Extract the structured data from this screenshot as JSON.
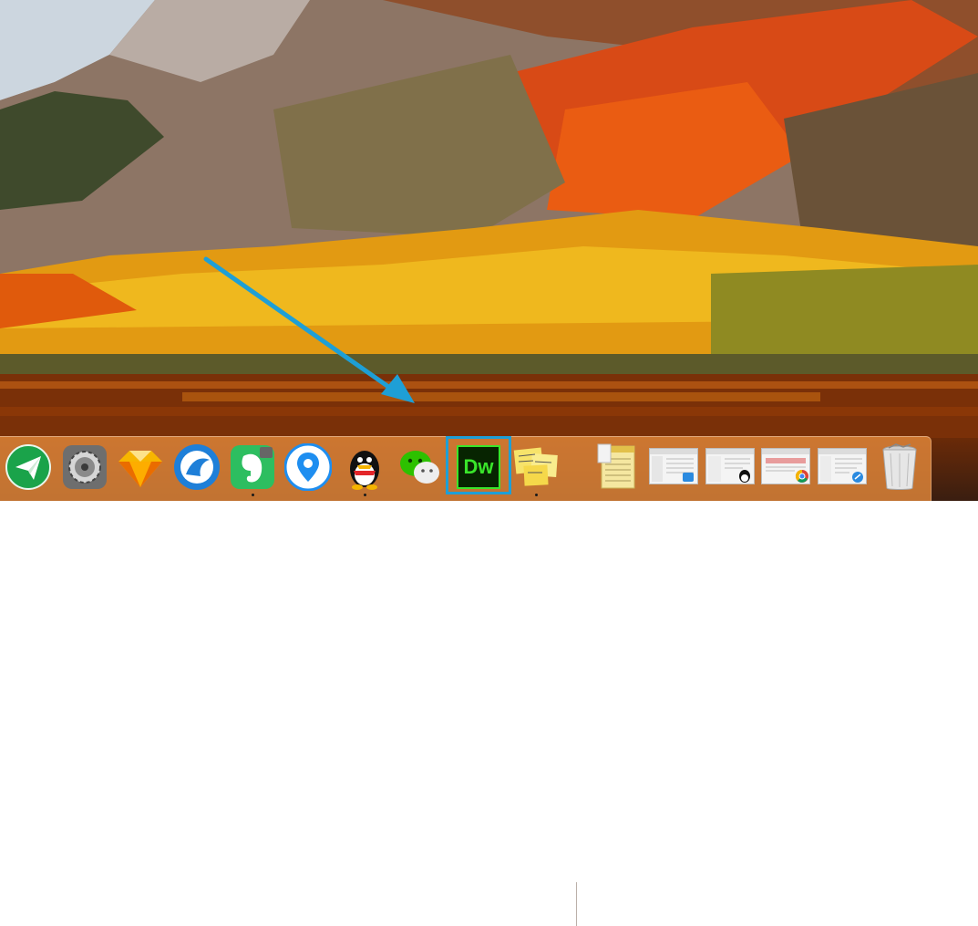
{
  "dock": {
    "apps": [
      {
        "id": "airmail",
        "icon": "paper-plane-icon",
        "color": "#1aa34a"
      },
      {
        "id": "system-preferences",
        "icon": "gear-icon",
        "color": "#7a7a7a"
      },
      {
        "id": "sketch",
        "icon": "diamond-icon",
        "color": "#f7b500"
      },
      {
        "id": "browser",
        "icon": "wave-icon",
        "color": "#1e7fd8"
      },
      {
        "id": "evernote",
        "icon": "elephant-icon",
        "color": "#2dbe60"
      },
      {
        "id": "maps",
        "icon": "location-pin-icon",
        "color": "#1e8ef0"
      },
      {
        "id": "qq",
        "icon": "penguin-icon",
        "color": "#111111"
      },
      {
        "id": "wechat",
        "icon": "chat-bubbles-icon",
        "color": "#2dc100"
      },
      {
        "id": "dreamweaver",
        "icon": "dw-icon",
        "label": "Dw",
        "color": "#072401",
        "selected": true
      },
      {
        "id": "stickies",
        "icon": "sticky-notes-icon",
        "color": "#f7e36a"
      },
      {
        "id": "textedit",
        "icon": "notepad-icon",
        "color": "#f5e7a0"
      },
      {
        "id": "finder-window",
        "icon": "window-thumbnail-icon",
        "color": "#e8e8e8"
      },
      {
        "id": "qq-window",
        "icon": "window-thumbnail-icon",
        "color": "#e8e8e8"
      },
      {
        "id": "chrome-window",
        "icon": "window-thumbnail-icon",
        "color": "#e8e8e8"
      },
      {
        "id": "app-store-window",
        "icon": "window-thumbnail-icon",
        "color": "#e8e8e8"
      },
      {
        "id": "trash",
        "icon": "trash-icon",
        "color": "#dcdcdc"
      }
    ],
    "running_indicators": [
      "evernote",
      "qq",
      "stickies"
    ],
    "accent_color": "#1e9fd6"
  }
}
